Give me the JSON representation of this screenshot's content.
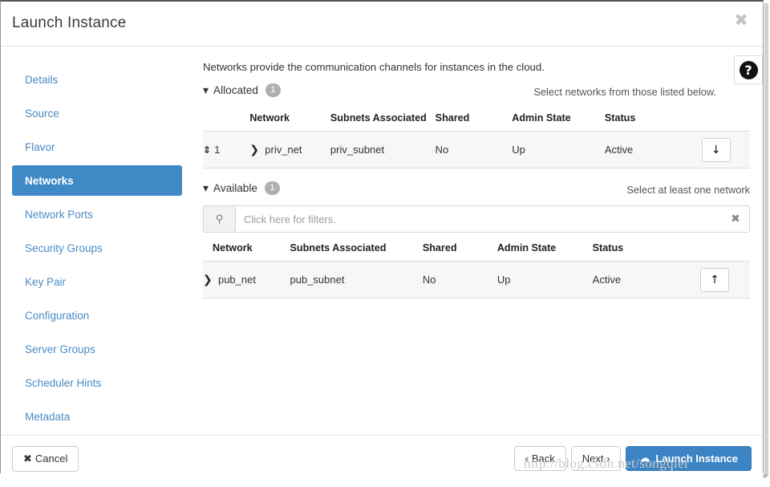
{
  "window": {
    "title": "Launch Instance",
    "close_icon": "close-icon"
  },
  "sidebar": {
    "items": [
      {
        "label": "Details",
        "active": false
      },
      {
        "label": "Source",
        "active": false
      },
      {
        "label": "Flavor",
        "active": false
      },
      {
        "label": "Networks",
        "active": true
      },
      {
        "label": "Network Ports",
        "active": false
      },
      {
        "label": "Security Groups",
        "active": false
      },
      {
        "label": "Key Pair",
        "active": false
      },
      {
        "label": "Configuration",
        "active": false
      },
      {
        "label": "Server Groups",
        "active": false
      },
      {
        "label": "Scheduler Hints",
        "active": false
      },
      {
        "label": "Metadata",
        "active": false
      }
    ]
  },
  "main": {
    "intro": "Networks provide the communication channels for instances in the cloud.",
    "help_icon": "help-icon",
    "allocated": {
      "caret": "⌄",
      "label": "Allocated",
      "count": "1",
      "hint": "Select networks from those listed below.",
      "columns": [
        "",
        "Network",
        "Subnets Associated",
        "Shared",
        "Admin State",
        "Status",
        ""
      ],
      "rows": [
        {
          "order": "1",
          "network": "priv_net",
          "subnets": "priv_subnet",
          "shared": "No",
          "admin_state": "Up",
          "status": "Active",
          "action_icon": "arrow-down-icon",
          "action_glyph": "↓"
        }
      ]
    },
    "available": {
      "caret": "⌄",
      "label": "Available",
      "count": "1",
      "hint": "Select at least one network",
      "filter": {
        "icon": "search-icon",
        "value": "",
        "placeholder": "Click here for filters.",
        "clear_icon": "clear-icon"
      },
      "columns": [
        "Network",
        "Subnets Associated",
        "Shared",
        "Admin State",
        "Status",
        ""
      ],
      "rows": [
        {
          "network": "pub_net",
          "subnets": "pub_subnet",
          "shared": "No",
          "admin_state": "Up",
          "status": "Active",
          "action_icon": "arrow-up-icon",
          "action_glyph": "↑"
        }
      ]
    }
  },
  "footer": {
    "cancel": "Cancel",
    "cancel_icon": "✖",
    "back": "‹ Back",
    "next": "Next ›",
    "launch": "Launch Instance",
    "launch_icon": "☁"
  },
  "watermark": "http://blog.csdn.net/songqier",
  "colors": {
    "accent": "#4089c7",
    "primary_button": "#3c84c4",
    "link": "#4a8bc4",
    "badge": "#b0b0b0",
    "row_bg": "#f7f7f7"
  }
}
